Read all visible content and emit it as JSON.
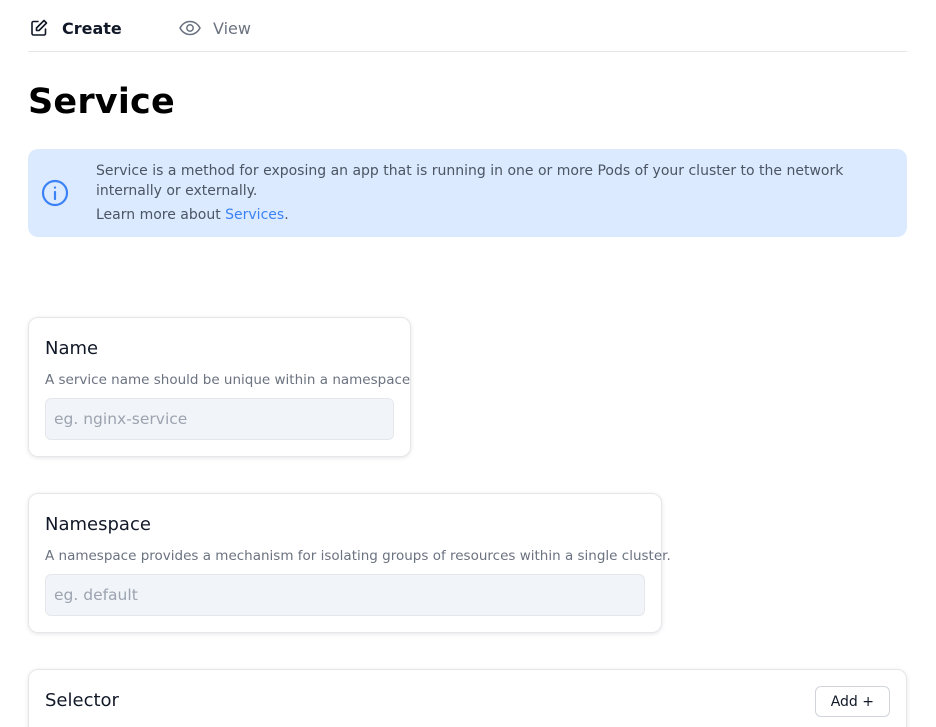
{
  "tabs": [
    {
      "label": "Create",
      "icon": "edit-icon",
      "active": true
    },
    {
      "label": "View",
      "icon": "eye-icon",
      "active": false
    }
  ],
  "page": {
    "title": "Service"
  },
  "info": {
    "icon": "info-icon",
    "text": "Service is a method for exposing an app that is running in one or more Pods of your cluster to the network internally or externally.",
    "learn_prefix": "Learn more about ",
    "learn_link": "Services",
    "learn_suffix": ".",
    "color_bg": "#dbeafe",
    "color_icon": "#3b82f6"
  },
  "name_card": {
    "title": "Name",
    "description": "A service name should be unique within a namespace",
    "placeholder": "eg. nginx-service",
    "value": ""
  },
  "namespace_card": {
    "title": "Namespace",
    "description": "A namespace provides a mechanism for isolating groups of resources within a single cluster.",
    "placeholder": "eg. default",
    "value": ""
  },
  "selector_card": {
    "title": "Selector",
    "add_label": "Add +"
  }
}
